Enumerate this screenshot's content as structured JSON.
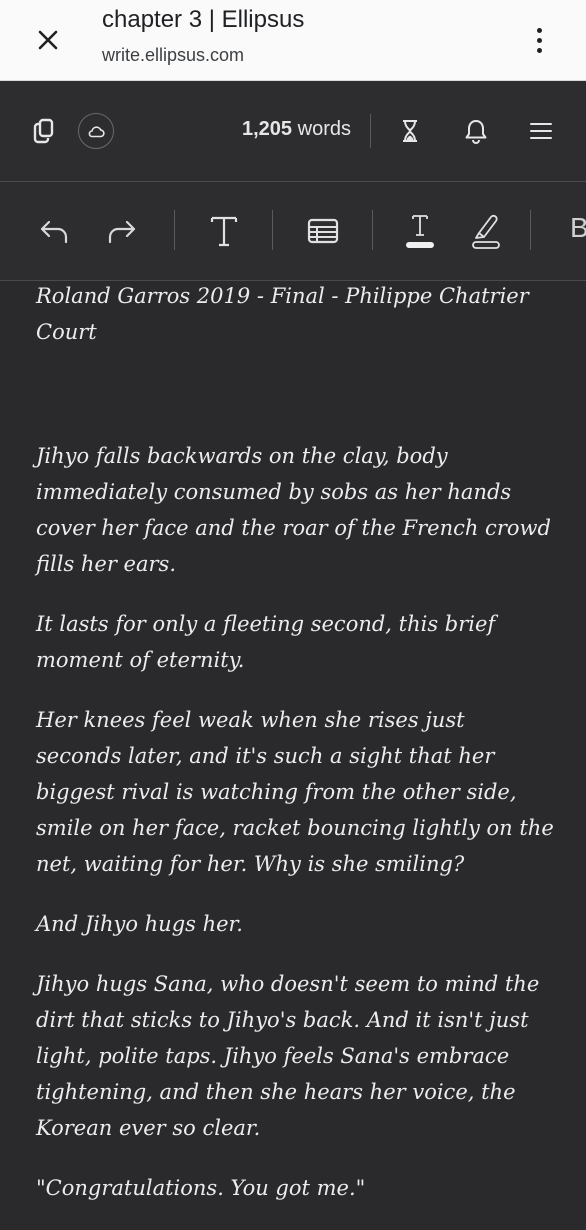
{
  "browser": {
    "title": "chapter 3 | Ellipsus",
    "url": "write.ellipsus.com"
  },
  "editor": {
    "word_count_number": "1,205",
    "word_count_label": "words"
  },
  "toolbar": {
    "cut_off_label": "B"
  },
  "document": {
    "heading": "Roland Garros 2019 - Final -  Philippe Chatrier Court",
    "paragraphs": [
      "Jihyo falls backwards on the clay, body immediately consumed by sobs as her hands cover her face and the roar of the French crowd fills her ears.",
      "It lasts for only a fleeting second, this brief moment of eternity.",
      "Her knees feel weak when she rises just seconds later, and it's such a sight that her biggest rival is watching from the other side, smile on her face, racket bouncing lightly on the net, waiting for her. Why is she smiling?",
      "And Jihyo hugs her.",
      "Jihyo hugs Sana, who doesn't seem to mind the dirt that sticks to Jihyo's back. And it isn't just light, polite taps. Jihyo feels Sana's embrace tightening, and then she hears her voice, the Korean ever so clear.",
      "\"Congratulations. You got me.\""
    ]
  }
}
